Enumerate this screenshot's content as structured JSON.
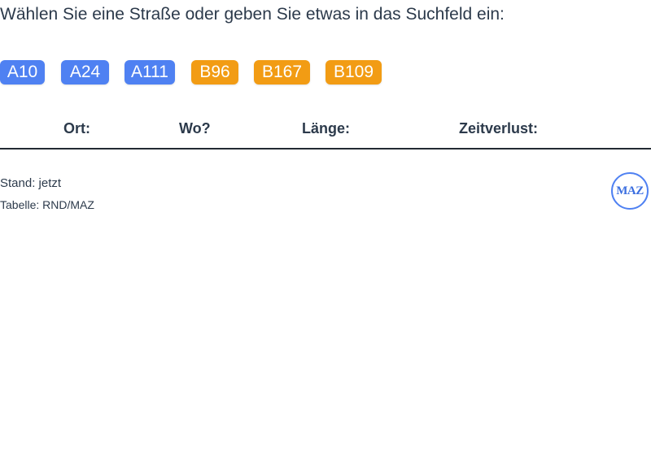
{
  "prompt": "Wählen Sie eine Straße oder geben Sie etwas in das Suchfeld ein:",
  "roads": [
    {
      "label": "A10",
      "type": "autobahn"
    },
    {
      "label": "A24",
      "type": "autobahn"
    },
    {
      "label": "A111",
      "type": "autobahn"
    },
    {
      "label": "B96",
      "type": "bundesstrasse"
    },
    {
      "label": "B167",
      "type": "bundesstrasse"
    },
    {
      "label": "B109",
      "type": "bundesstrasse"
    }
  ],
  "colors": {
    "autobahn": "#4f81f2",
    "bundesstrasse": "#f29c14",
    "divider": "#222a33",
    "text": "#2c3a4b"
  },
  "table": {
    "columns": [
      "Ort:",
      "Wo?",
      "Länge:",
      "Zeitverlust:"
    ],
    "rows": []
  },
  "footer": {
    "status": "Stand: jetzt",
    "source": "Tabelle: RND/MAZ"
  },
  "logo": {
    "text": "MAZ",
    "icon": "maz-logo-icon"
  }
}
